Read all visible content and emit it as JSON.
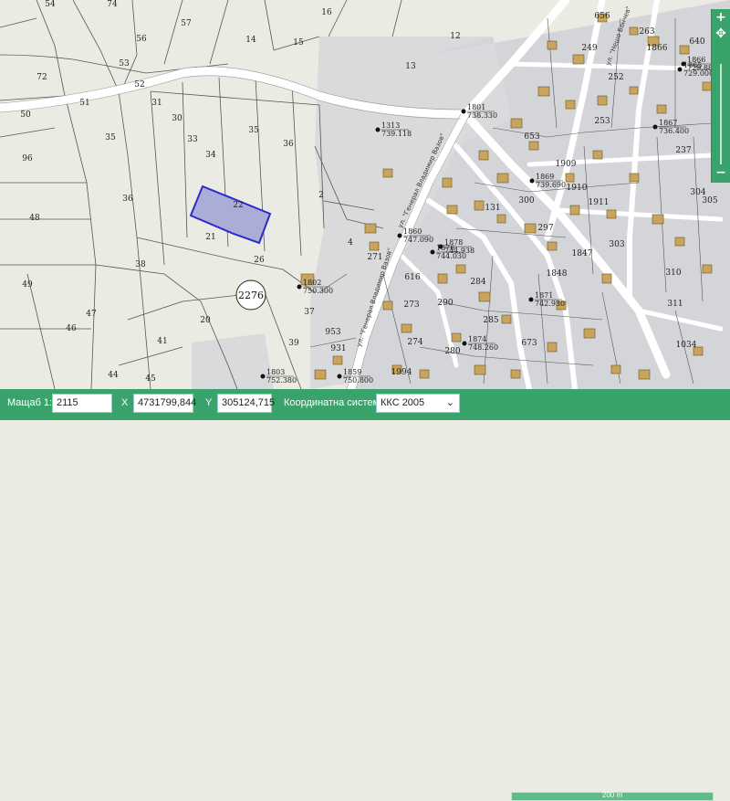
{
  "map": {
    "parcel_labels": [
      {
        "text": "54"
      },
      {
        "text": "74"
      },
      {
        "text": "57"
      },
      {
        "text": "56"
      },
      {
        "text": "53"
      },
      {
        "text": "72"
      },
      {
        "text": "52"
      },
      {
        "text": "51"
      },
      {
        "text": "50"
      },
      {
        "text": "31"
      },
      {
        "text": "30"
      },
      {
        "text": "35"
      },
      {
        "text": "33"
      },
      {
        "text": "36"
      },
      {
        "text": "34"
      },
      {
        "text": "96"
      },
      {
        "text": "35"
      },
      {
        "text": "36"
      },
      {
        "text": "48"
      },
      {
        "text": "22"
      },
      {
        "text": "21"
      },
      {
        "text": "38"
      },
      {
        "text": "26"
      },
      {
        "text": "49"
      },
      {
        "text": "47"
      },
      {
        "text": "20"
      },
      {
        "text": "46"
      },
      {
        "text": "41"
      },
      {
        "text": "44"
      },
      {
        "text": "45"
      },
      {
        "text": "37"
      },
      {
        "text": "39"
      },
      {
        "text": "16"
      },
      {
        "text": "14"
      },
      {
        "text": "15"
      },
      {
        "text": "12"
      },
      {
        "text": "13"
      },
      {
        "text": "2"
      },
      {
        "text": "4"
      },
      {
        "text": "271"
      },
      {
        "text": "953"
      },
      {
        "text": "931"
      },
      {
        "text": "274"
      },
      {
        "text": "273"
      },
      {
        "text": "616"
      },
      {
        "text": "290"
      },
      {
        "text": "280"
      },
      {
        "text": "1994"
      },
      {
        "text": "653"
      },
      {
        "text": "1909"
      },
      {
        "text": "1910"
      },
      {
        "text": "1911"
      },
      {
        "text": "297"
      },
      {
        "text": "300"
      },
      {
        "text": "303"
      },
      {
        "text": "1848"
      },
      {
        "text": "1847"
      },
      {
        "text": "310"
      },
      {
        "text": "311"
      },
      {
        "text": "1034"
      },
      {
        "text": "304"
      },
      {
        "text": "305"
      },
      {
        "text": "237"
      },
      {
        "text": "253"
      },
      {
        "text": "249"
      },
      {
        "text": "252"
      },
      {
        "text": "640"
      },
      {
        "text": "656"
      },
      {
        "text": "1866"
      },
      {
        "text": "263"
      },
      {
        "text": "285"
      },
      {
        "text": "673"
      },
      {
        "text": "284"
      },
      {
        "text": "131"
      }
    ],
    "big_parcel_id": "2276",
    "survey_points": [
      {
        "id": "1313",
        "elev": "739.118"
      },
      {
        "id": "1801",
        "elev": "738.330"
      },
      {
        "id": "1803",
        "elev": "752.380"
      },
      {
        "id": "1802",
        "elev": "750.300"
      },
      {
        "id": "1859",
        "elev": "750.800"
      },
      {
        "id": "1860",
        "elev": "747.090"
      },
      {
        "id": "1878",
        "elev": "744.938"
      },
      {
        "id": "1876",
        "elev": "744.030"
      },
      {
        "id": "1869",
        "elev": "739.690"
      },
      {
        "id": "1867",
        "elev": "736.400"
      },
      {
        "id": "1865",
        "elev": "729.000"
      },
      {
        "id": "1871",
        "elev": "742.930"
      },
      {
        "id": "1874",
        "elev": "748.260"
      },
      {
        "id": "1866",
        "elev": "729.880"
      }
    ],
    "street_labels": [
      "ул. \"Генерал Владимир Вазов\"",
      "ул. \"Нешо Бончев\""
    ]
  },
  "toolbar": {
    "scale_label": "Мащаб 1:",
    "scale_value": "2115",
    "x_label": "X",
    "x_value": "4731799,844",
    "y_label": "Y",
    "y_value": "305124,715",
    "coord_label": "Координатна система",
    "coord_value": "ККС 2005",
    "scale_bar_text": "200 m"
  },
  "colors": {
    "background": "#ecebe3",
    "urban_area": "#d7d8da",
    "building": "#c9a45c",
    "selected_parcel": "#aaaed6",
    "selected_border": "#2a2ad0",
    "accent": "#3aa36c"
  },
  "zoom": {
    "plus": "+",
    "minus": "−"
  }
}
